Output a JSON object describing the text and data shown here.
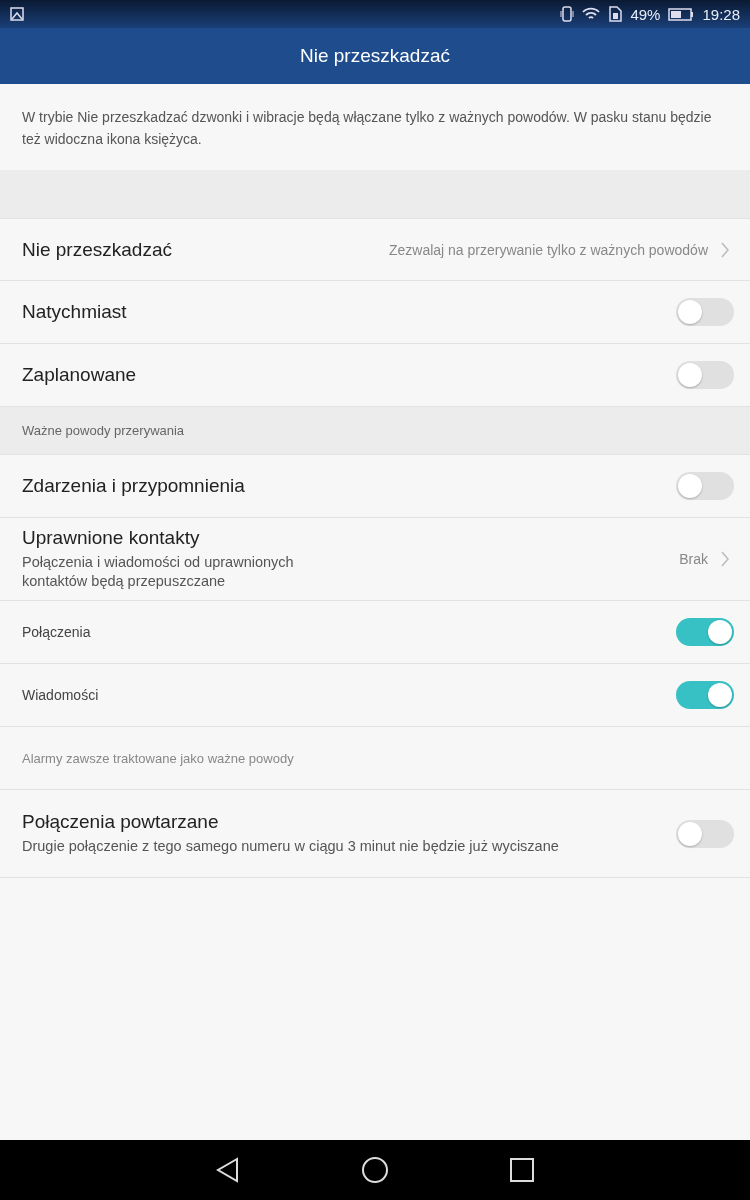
{
  "status_bar": {
    "battery": "49%",
    "time": "19:28"
  },
  "app_bar": {
    "title": "Nie przeszkadzać"
  },
  "description": "W trybie Nie przeszkadzać dzwonki i wibracje będą włączane tylko z ważnych powodów. W pasku stanu będzie też widoczna ikona księżyca.",
  "rows": [
    {
      "kind": "spacer"
    },
    {
      "kind": "link",
      "title": "Nie przeszkadzać",
      "value": "Zezwalaj na przerywanie tylko z ważnych powodów"
    },
    {
      "kind": "toggle",
      "title": "Natychmiast",
      "on": false
    },
    {
      "kind": "toggle",
      "title": "Zaplanowane",
      "on": false
    },
    {
      "kind": "header",
      "title": "Ważne powody przerywania"
    },
    {
      "kind": "toggle",
      "title": "Zdarzenia i przypomnienia",
      "on": false
    },
    {
      "kind": "link",
      "title": "Uprawnione kontakty",
      "subtitle": "Połączenia i wiadomości od uprawnionych kontaktów będą przepuszczane",
      "value": "Brak"
    },
    {
      "kind": "subtoggle",
      "title": "Połączenia",
      "on": true
    },
    {
      "kind": "subtoggle",
      "title": "Wiadomości",
      "on": true
    },
    {
      "kind": "note",
      "title": "Alarmy zawsze traktowane jako ważne powody"
    },
    {
      "kind": "toggle",
      "title": "Połączenia powtarzane",
      "subtitle": "Drugie połączenie z tego samego numeru w ciągu 3 minut nie będzie już wyciszane",
      "on": false
    }
  ]
}
